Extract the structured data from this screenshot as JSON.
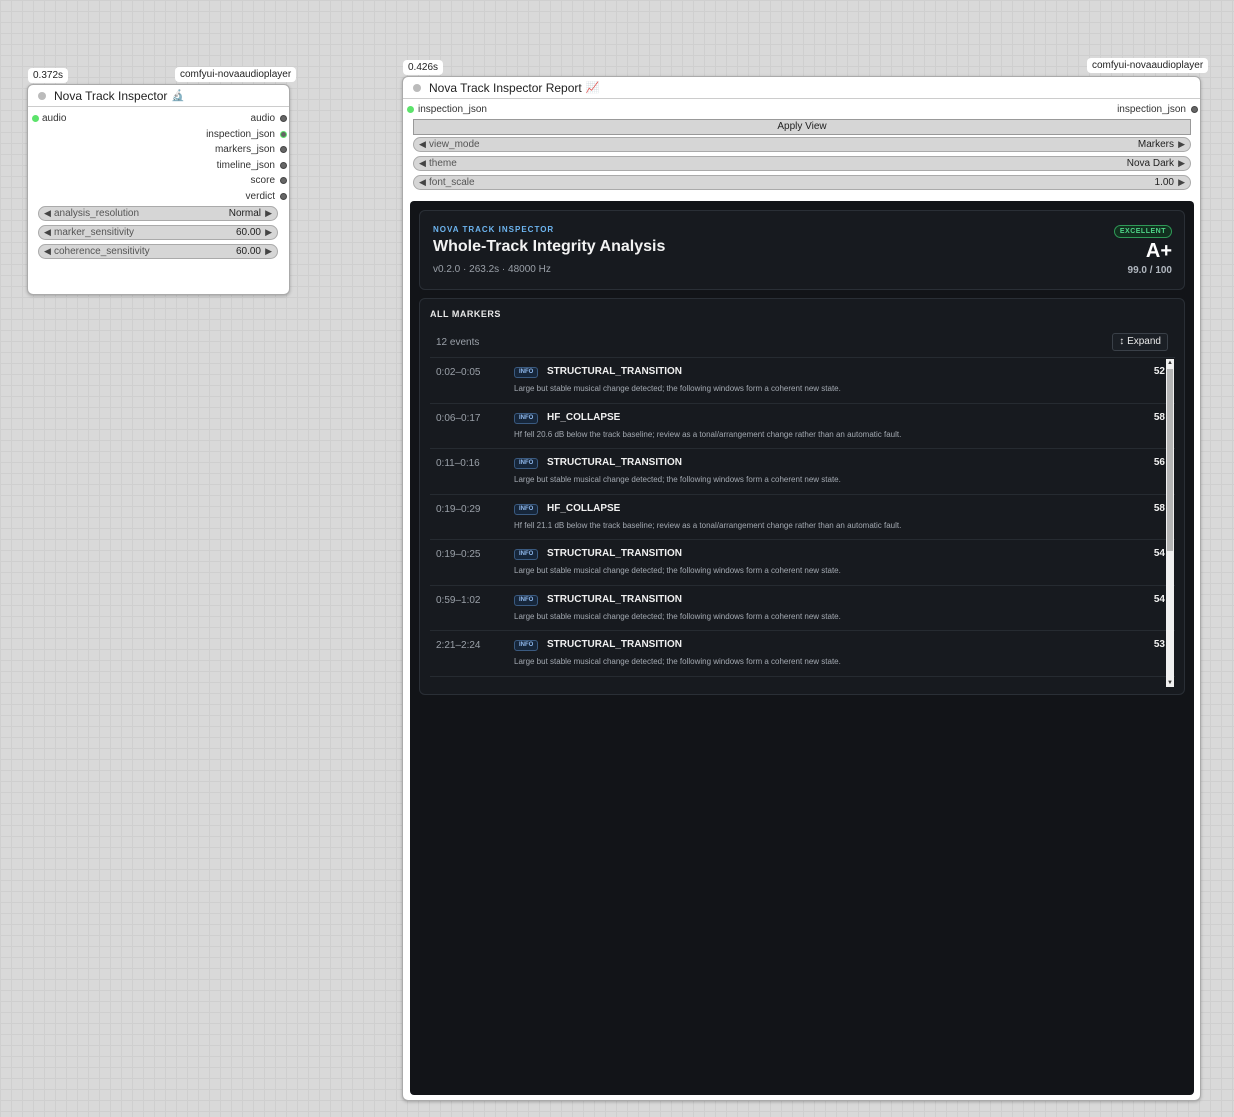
{
  "inspector_node": {
    "time_badge": "0.372s",
    "package_badge": "comfyui-novaaudioplayer",
    "title": "Nova Track Inspector",
    "title_emoji": "🔬",
    "input": "audio",
    "outputs": [
      "audio",
      "inspection_json",
      "markers_json",
      "timeline_json",
      "score",
      "verdict"
    ],
    "widgets": [
      {
        "label": "analysis_resolution",
        "value": "Normal"
      },
      {
        "label": "marker_sensitivity",
        "value": "60.00"
      },
      {
        "label": "coherence_sensitivity",
        "value": "60.00"
      }
    ]
  },
  "report_node": {
    "time_badge": "0.426s",
    "package_badge": "comfyui-novaaudioplayer",
    "title": "Nova Track Inspector Report",
    "title_emoji": "📈",
    "input": "inspection_json",
    "output": "inspection_json",
    "apply_button": "Apply View",
    "widgets": [
      {
        "label": "view_mode",
        "value": "Markers"
      },
      {
        "label": "theme",
        "value": "Nova Dark"
      },
      {
        "label": "font_scale",
        "value": "1.00"
      }
    ]
  },
  "report": {
    "eyebrow": "NOVA TRACK INSPECTOR",
    "title": "Whole-Track Integrity Analysis",
    "subtitle": "v0.2.0 · 263.2s · 48000 Hz",
    "grade_badge": "EXCELLENT",
    "grade": "A+",
    "score": "99.0 / 100",
    "markers_heading": "ALL MARKERS",
    "event_count": "12 events",
    "expand_label": "↕ Expand",
    "markers": [
      {
        "time": "0:02–0:05",
        "tag": "INFO",
        "name": "STRUCTURAL_TRANSITION",
        "desc": "Large but stable musical change detected; the following windows form a coherent new state.",
        "score": "52"
      },
      {
        "time": "0:06–0:17",
        "tag": "INFO",
        "name": "HF_COLLAPSE",
        "desc": "Hf fell 20.6 dB below the track baseline; review as a tonal/arrangement change rather than an automatic fault.",
        "score": "58"
      },
      {
        "time": "0:11–0:16",
        "tag": "INFO",
        "name": "STRUCTURAL_TRANSITION",
        "desc": "Large but stable musical change detected; the following windows form a coherent new state.",
        "score": "56"
      },
      {
        "time": "0:19–0:29",
        "tag": "INFO",
        "name": "HF_COLLAPSE",
        "desc": "Hf fell 21.1 dB below the track baseline; review as a tonal/arrangement change rather than an automatic fault.",
        "score": "58"
      },
      {
        "time": "0:19–0:25",
        "tag": "INFO",
        "name": "STRUCTURAL_TRANSITION",
        "desc": "Large but stable musical change detected; the following windows form a coherent new state.",
        "score": "54"
      },
      {
        "time": "0:59–1:02",
        "tag": "INFO",
        "name": "STRUCTURAL_TRANSITION",
        "desc": "Large but stable musical change detected; the following windows form a coherent new state.",
        "score": "54"
      },
      {
        "time": "2:21–2:24",
        "tag": "INFO",
        "name": "STRUCTURAL_TRANSITION",
        "desc": "Large but stable musical change detected; the following windows form a coherent new state.",
        "score": "53"
      }
    ]
  }
}
